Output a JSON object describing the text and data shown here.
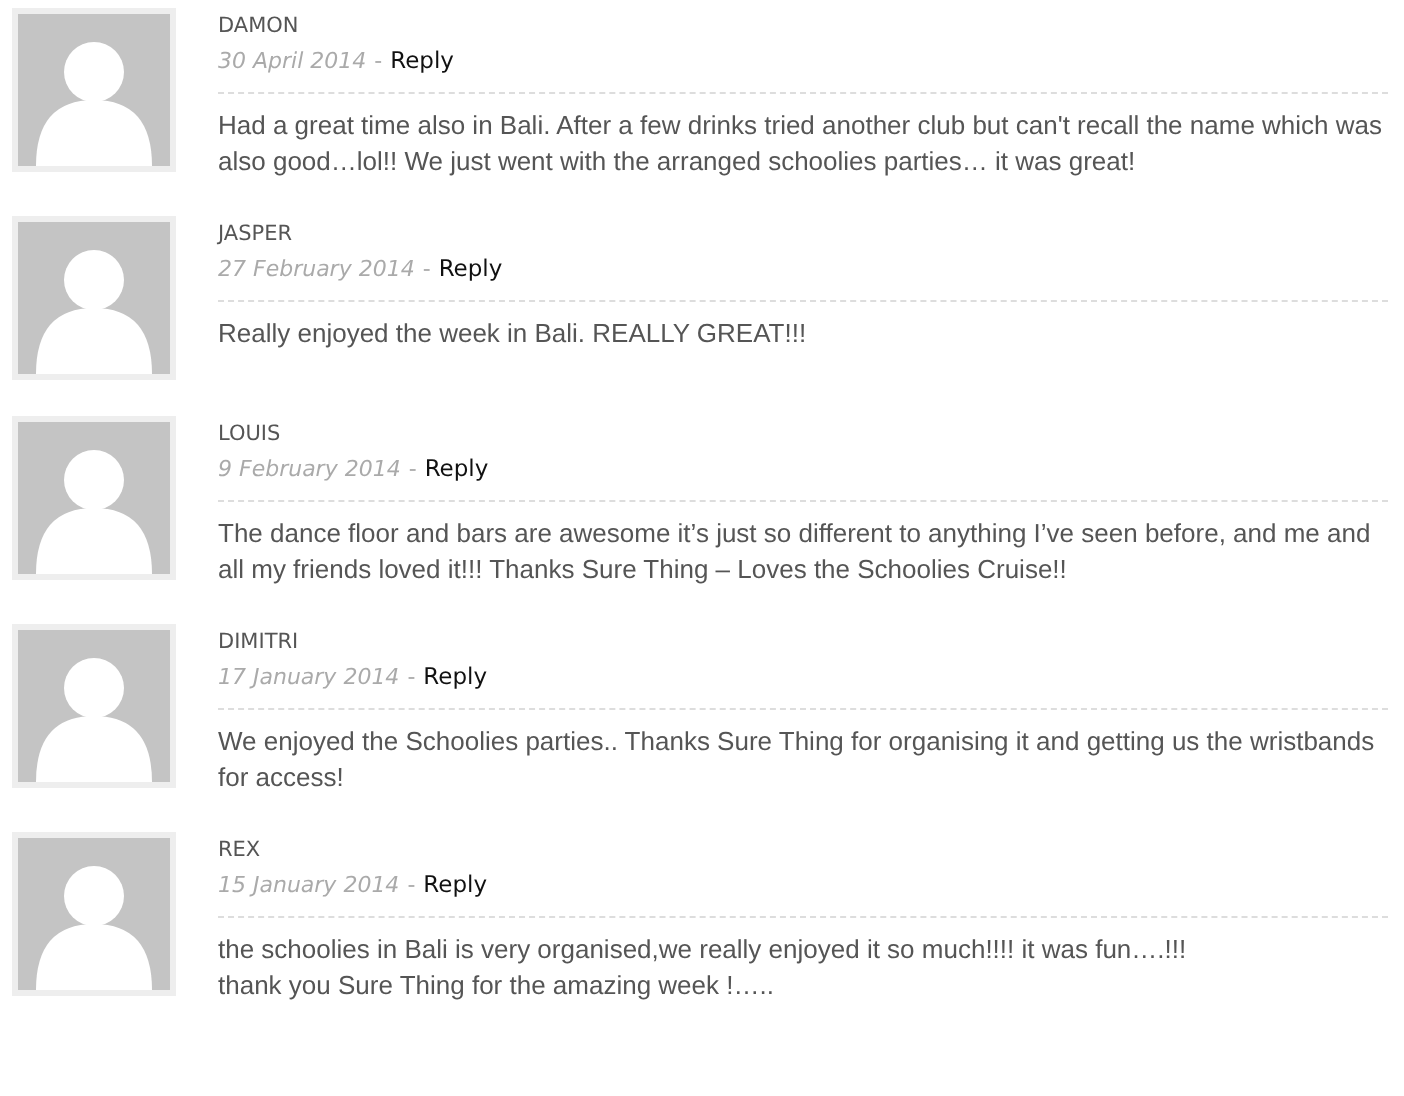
{
  "comments": [
    {
      "author": "DAMON",
      "date": "30 April 2014",
      "separator": "-",
      "reply": "Reply",
      "text": "Had a great time also in Bali. After a few drinks tried another club but can't recall the name which was also good…lol!! We just went with the arranged schoolies parties… it was great!"
    },
    {
      "author": "JASPER",
      "date": "27 February 2014",
      "separator": "-",
      "reply": "Reply",
      "text": "Really enjoyed the week in Bali. REALLY GREAT!!!"
    },
    {
      "author": "LOUIS",
      "date": "9 February 2014",
      "separator": "-",
      "reply": "Reply",
      "text": "The dance floor and bars are awesome it’s just so different to anything I’ve seen before, and me and all my friends loved it!!! Thanks Sure Thing – Loves the Schoolies Cruise!!"
    },
    {
      "author": "DIMITRI",
      "date": "17 January 2014",
      "separator": "-",
      "reply": "Reply",
      "text": "We enjoyed the Schoolies parties.. Thanks Sure Thing for organising it and getting us the wristbands for access!"
    },
    {
      "author": "REX",
      "date": "15 January 2014",
      "separator": "-",
      "reply": "Reply",
      "text": "the schoolies in Bali is very organised,we really enjoyed it so much!!!! it was fun….!!!\nthank you Sure Thing for the amazing week !….."
    }
  ]
}
